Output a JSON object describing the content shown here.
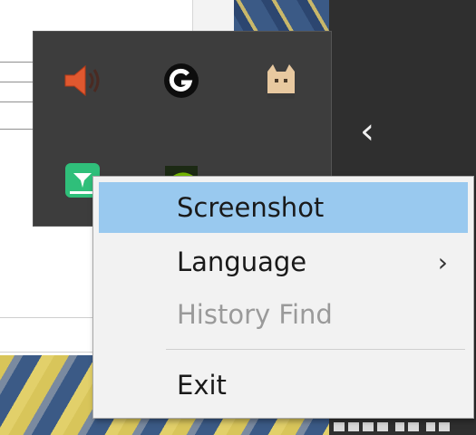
{
  "tray": {
    "expand_glyph": "‹",
    "icons": [
      {
        "name": "speaker-icon"
      },
      {
        "name": "logitech-g-icon"
      },
      {
        "name": "cat-app-icon"
      },
      {
        "name": "green-app-icon"
      },
      {
        "name": "nvidia-icon"
      }
    ]
  },
  "context_menu": {
    "items": [
      {
        "label": "Screenshot",
        "state": "highlighted"
      },
      {
        "label": "Language",
        "submenu_arrow": "›",
        "state": "normal"
      },
      {
        "label": "History Find",
        "state": "disabled"
      },
      {
        "label": "Exit",
        "state": "normal"
      }
    ]
  },
  "colors": {
    "menu_highlight": "#99c9ef",
    "menu_background": "#f2f2f2",
    "flyout_background": "#3d3d3d",
    "disabled_text": "#9a9a9a"
  }
}
